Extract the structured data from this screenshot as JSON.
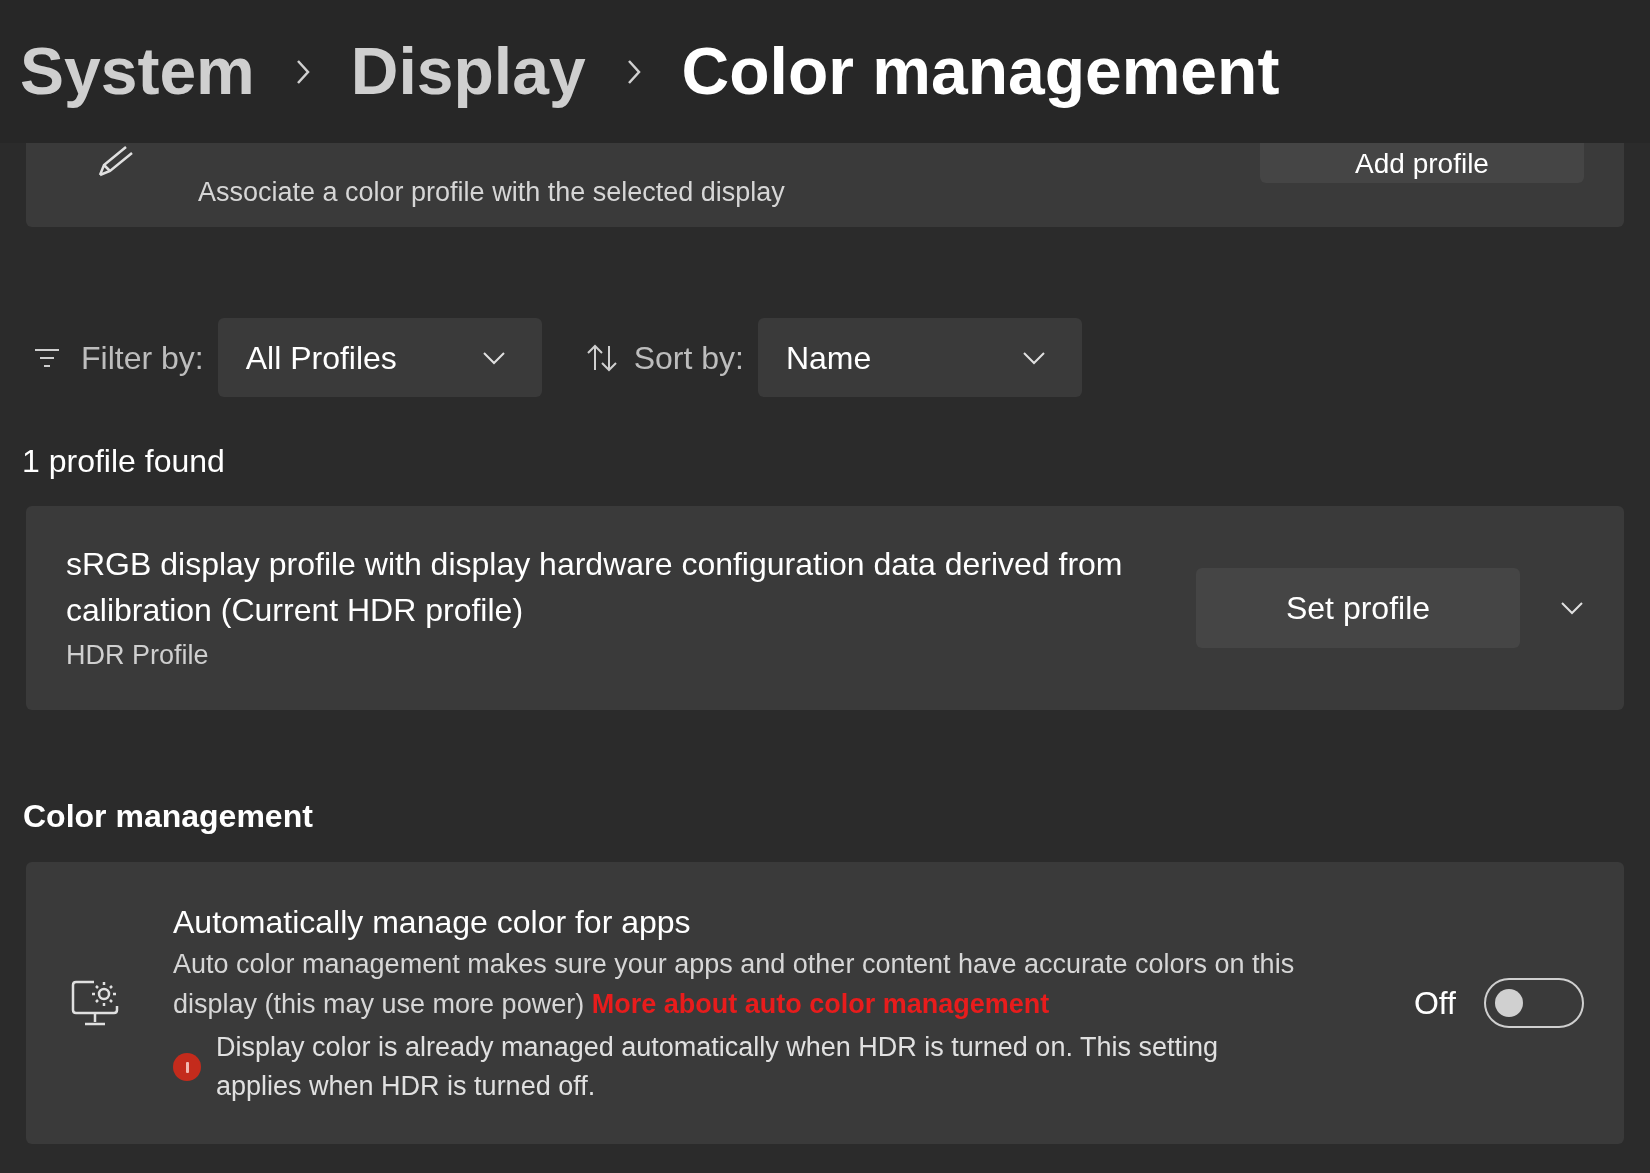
{
  "breadcrumb": [
    "System",
    "Display",
    "Color management"
  ],
  "add_profile_card": {
    "description": "Associate a color profile with the selected display",
    "button": "Add profile"
  },
  "filter": {
    "label": "Filter by:",
    "value": "All Profiles"
  },
  "sort": {
    "label": "Sort by:",
    "value": "Name"
  },
  "result_count": "1 profile found",
  "profiles": [
    {
      "title": "sRGB display profile with display hardware configuration data derived from calibration (Current HDR profile)",
      "subtitle": "HDR Profile",
      "button": "Set profile",
      "expanded": false
    }
  ],
  "section_heading": "Color management",
  "auto_color": {
    "title": "Automatically manage color for apps",
    "description": "Auto color management makes sure your apps and other content have accurate colors on this display (this may use more power)",
    "link": "More about auto color management",
    "warning": "Display color is already managed automatically when HDR is turned on. This setting applies when HDR is turned off.",
    "state_label": "Off",
    "on": false
  }
}
